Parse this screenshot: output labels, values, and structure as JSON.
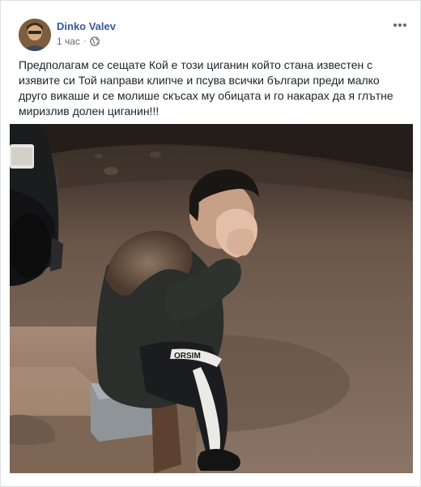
{
  "post": {
    "author": "Dinko Valev",
    "time": "1 час",
    "separator": "·",
    "privacy_icon": "globe-icon",
    "menu_icon": "more-options-icon",
    "text": "Предполагам се сещате Кой е този циганин който стана известен с изявите си Той направи клипче и псува всички българи преди малко друго викаше и се молише скъсах му обицата и го накарах да я глътне миризлив долен циганин!!!",
    "photo_icon": "post-photo",
    "shirt_print": "ORSIM"
  }
}
